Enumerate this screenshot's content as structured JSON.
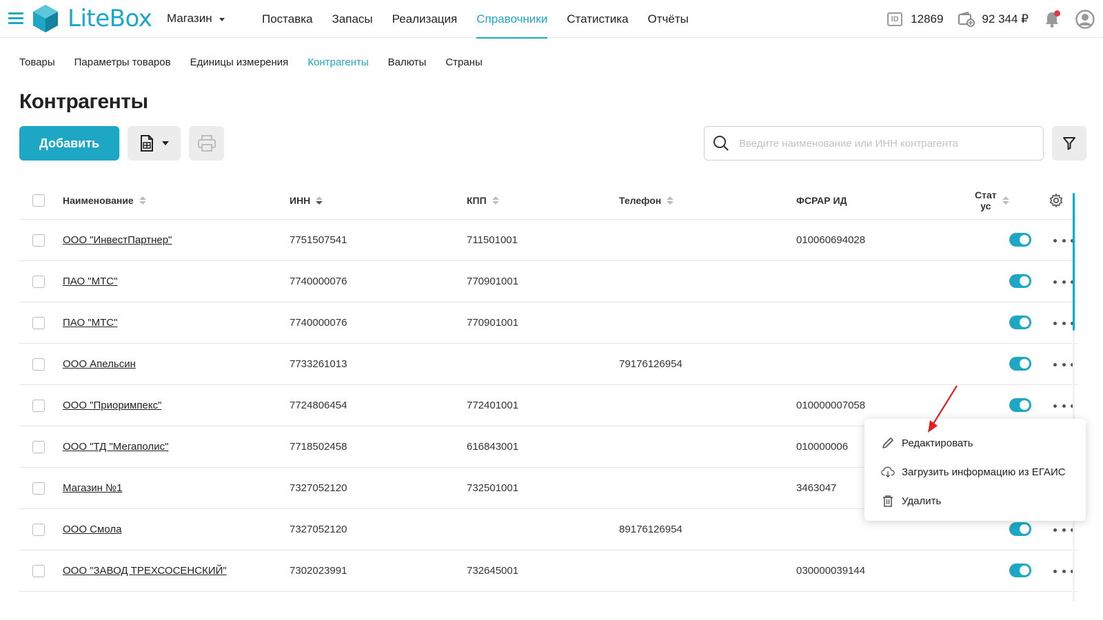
{
  "header": {
    "logo_text": "LiteBox",
    "store": "Магазин",
    "nav": [
      {
        "label": "Поставка",
        "active": false
      },
      {
        "label": "Запасы",
        "active": false
      },
      {
        "label": "Реализация",
        "active": false
      },
      {
        "label": "Справочники",
        "active": true
      },
      {
        "label": "Статистика",
        "active": false
      },
      {
        "label": "Отчёты",
        "active": false
      }
    ],
    "account_id": "12869",
    "balance": "92 344 ₽"
  },
  "subnav": [
    {
      "label": "Товары",
      "active": false
    },
    {
      "label": "Параметры товаров",
      "active": false
    },
    {
      "label": "Единицы измерения",
      "active": false
    },
    {
      "label": "Контрагенты",
      "active": true
    },
    {
      "label": "Валюты",
      "active": false
    },
    {
      "label": "Страны",
      "active": false
    }
  ],
  "page": {
    "title": "Контрагенты",
    "add_label": "Добавить",
    "search_placeholder": "Введите наименование или ИНН контрагента"
  },
  "table": {
    "columns": {
      "name": "Наименование",
      "inn": "ИНН",
      "kpp": "КПП",
      "phone": "Телефон",
      "fsrar": "ФСРАР ИД",
      "status_line1": "Стат",
      "status_line2": "ус"
    },
    "rows": [
      {
        "name": "ООО \"ИнвестПартнер\"",
        "inn": "7751507541",
        "kpp": "711501001",
        "phone": "",
        "fsrar": "010060694028",
        "status": true
      },
      {
        "name": "ПАО \"МТС\"",
        "inn": "7740000076",
        "kpp": "770901001",
        "phone": "",
        "fsrar": "",
        "status": true
      },
      {
        "name": "ПАО \"МТС\"",
        "inn": "7740000076",
        "kpp": "770901001",
        "phone": "",
        "fsrar": "",
        "status": true
      },
      {
        "name": "ООО Апельсин",
        "inn": "7733261013",
        "kpp": "",
        "phone": "79176126954",
        "fsrar": "",
        "status": true
      },
      {
        "name": "ООО \"Приоримпекс\"",
        "inn": "7724806454",
        "kpp": "772401001",
        "phone": "",
        "fsrar": "010000007058",
        "status": true
      },
      {
        "name": "ООО \"ТД \"Мегаполис\"",
        "inn": "7718502458",
        "kpp": "616843001",
        "phone": "",
        "fsrar": "010000006",
        "status": true
      },
      {
        "name": "Магазин №1",
        "inn": "7327052120",
        "kpp": "732501001",
        "phone": "",
        "fsrar": "3463047",
        "status": true
      },
      {
        "name": "ООО Смола",
        "inn": "7327052120",
        "kpp": "",
        "phone": "89176126954",
        "fsrar": "",
        "status": true
      },
      {
        "name": "ООО \"ЗАВОД ТРЕХСОСЕНСКИЙ\"",
        "inn": "7302023991",
        "kpp": "732645001",
        "phone": "",
        "fsrar": "030000039144",
        "status": true
      }
    ]
  },
  "context_menu": {
    "edit": "Редактировать",
    "load_egais": "Загрузить информацию из ЕГАИС",
    "delete": "Удалить"
  },
  "colors": {
    "accent": "#1ea7c4",
    "annotation_arrow": "#e02020",
    "notification_dot": "#e23744"
  }
}
